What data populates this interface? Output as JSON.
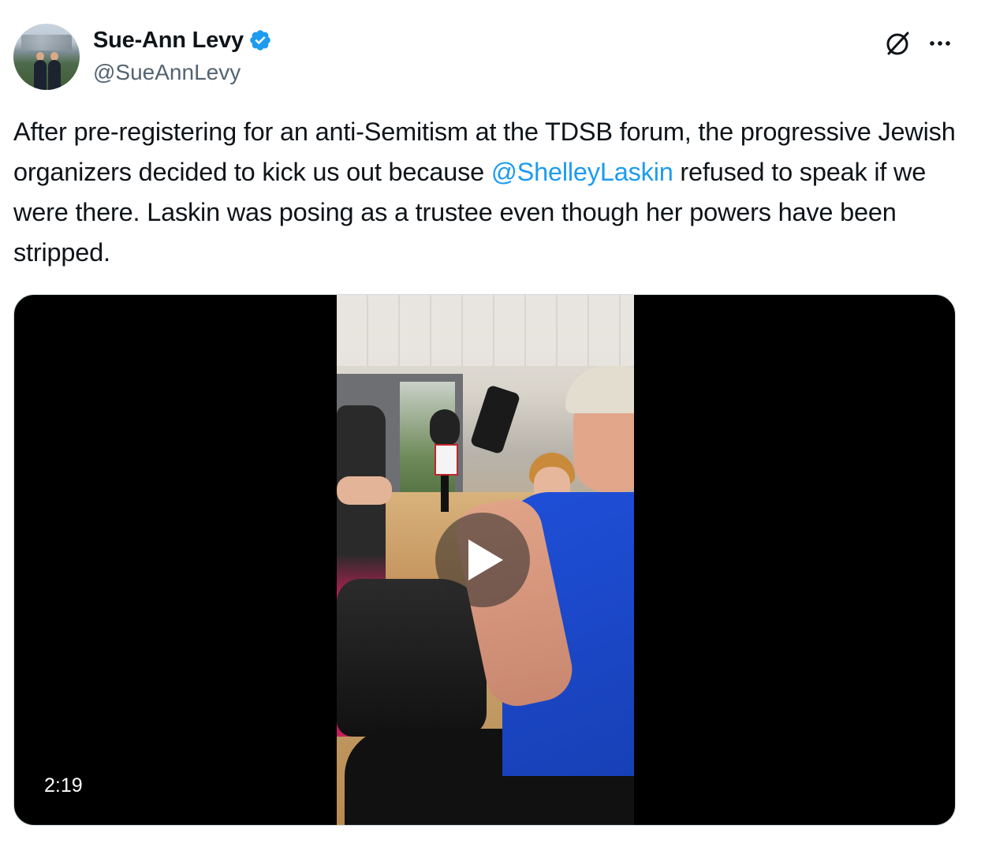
{
  "author": {
    "display_name": "Sue-Ann Levy",
    "handle": "@SueAnnLevy",
    "verified": true
  },
  "tweet": {
    "text_part1": "After pre-registering for an anti-Semitism at the TDSB forum, the progressive Jewish organizers decided to kick us out because ",
    "mention": "@ShelleyLaskin",
    "text_part2": " refused to speak if we were there. Laskin was posing as a trustee even though her powers have been stripped."
  },
  "media": {
    "type": "video",
    "duration": "2:19"
  },
  "icons": {
    "verified": "verified-badge-icon",
    "grok": "grok-icon",
    "more": "more-icon",
    "play": "play-icon"
  },
  "colors": {
    "link": "#1d9bf0",
    "verified": "#1d9bf0",
    "text": "#0f1419",
    "secondary": "#536471",
    "media_bg": "#000000"
  }
}
